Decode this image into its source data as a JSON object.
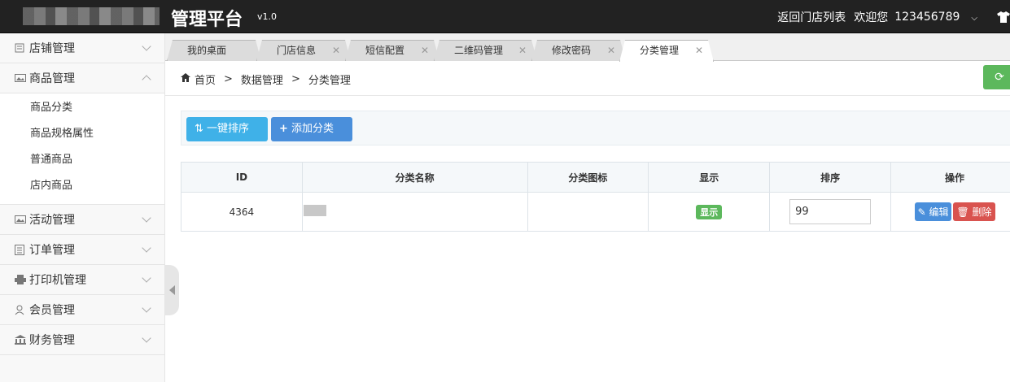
{
  "header": {
    "brand": "管理平台",
    "version": "v1.0",
    "back_link": "返回门店列表",
    "welcome": "欢迎您",
    "username": "123456789"
  },
  "sidebar": {
    "items": [
      {
        "label": "店铺管理",
        "icon": "book-icon"
      },
      {
        "label": "商品管理",
        "icon": "image-icon",
        "expanded": true,
        "children": [
          "商品分类",
          "商品规格属性",
          "普通商品",
          "店内商品"
        ]
      },
      {
        "label": "活动管理",
        "icon": "image-icon"
      },
      {
        "label": "订单管理",
        "icon": "list-icon"
      },
      {
        "label": "打印机管理",
        "icon": "printer-icon"
      },
      {
        "label": "会员管理",
        "icon": "user-icon"
      },
      {
        "label": "财务管理",
        "icon": "building-icon"
      }
    ]
  },
  "tabs": [
    {
      "label": "我的桌面",
      "closable": false
    },
    {
      "label": "门店信息",
      "closable": true
    },
    {
      "label": "短信配置",
      "closable": true
    },
    {
      "label": "二维码管理",
      "closable": true
    },
    {
      "label": "修改密码",
      "closable": true
    },
    {
      "label": "分类管理",
      "closable": true,
      "active": true
    }
  ],
  "breadcrumb": {
    "home": "首页",
    "level1": "数据管理",
    "level2": "分类管理"
  },
  "toolbar": {
    "sort_label": "一键排序",
    "add_label": "添加分类"
  },
  "table": {
    "columns": [
      "ID",
      "分类名称",
      "分类图标",
      "显示",
      "排序",
      "操作"
    ],
    "rows": [
      {
        "id": "4364",
        "name": "",
        "icon": "",
        "show": "显示",
        "sort": "99",
        "edit": "编辑",
        "delete": "删除"
      }
    ]
  },
  "colors": {
    "topbar": "#222222",
    "primary": "#4a8fdb",
    "info": "#3fb1e8",
    "success": "#5cb85c",
    "danger": "#d9534f"
  }
}
